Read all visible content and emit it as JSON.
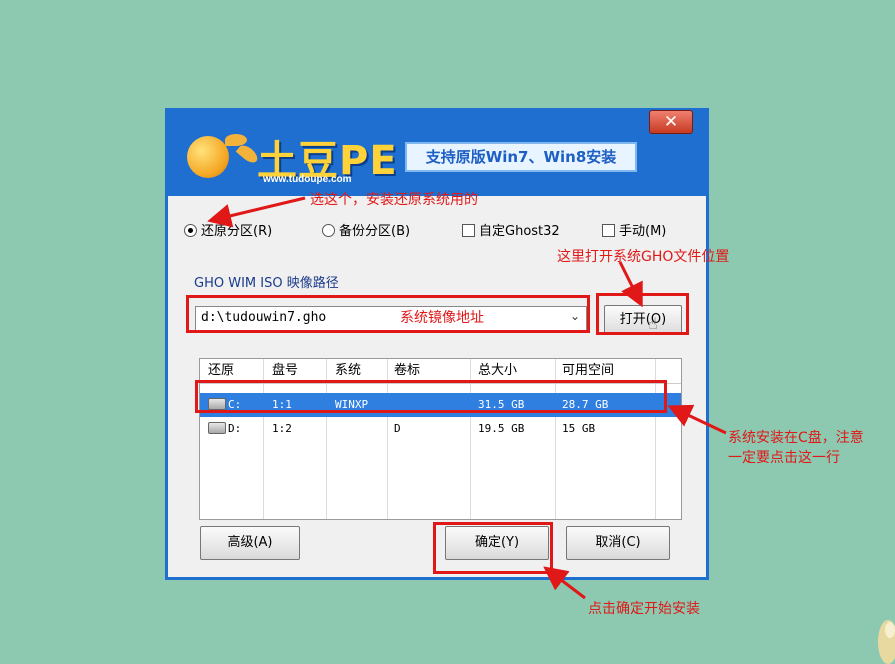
{
  "title": {
    "brand": "土豆PE",
    "url": "www.tudoupe.com",
    "banner": "支持原版Win7、Win8安装",
    "close_icon": "close-icon"
  },
  "options": [
    {
      "label": "还原分区(R)",
      "type": "radio",
      "checked": true
    },
    {
      "label": "备份分区(B)",
      "type": "radio",
      "checked": false
    },
    {
      "label": "自定Ghost32",
      "type": "checkbox",
      "checked": false
    },
    {
      "label": "手动(M)",
      "type": "checkbox",
      "checked": false
    }
  ],
  "image_path": {
    "label": "GHO WIM ISO 映像路径",
    "value": "d:\\tudouwin7.gho",
    "open_button": "打开(O)"
  },
  "table": {
    "columns": [
      "还原",
      "盘号",
      "系统",
      "卷标",
      "总大小",
      "可用空间"
    ],
    "rows": [
      {
        "drive": "C:",
        "disk_no": "1:1",
        "system": "WINXP",
        "volume": "",
        "total": "31.5 GB",
        "free": "28.7 GB",
        "selected": true
      },
      {
        "drive": "D:",
        "disk_no": "1:2",
        "system": "",
        "volume": "D",
        "total": "19.5 GB",
        "free": "15 GB",
        "selected": false
      }
    ]
  },
  "buttons": {
    "advanced": "高级(A)",
    "ok": "确定(Y)",
    "cancel": "取消(C)"
  },
  "annotations": {
    "select_hint": "选这个，安装还原系统用的",
    "open_hint": "这里打开系统GHO文件位置",
    "path_hint": "系统镜像地址",
    "drive_hint_1": "系统安装在C盘，注意",
    "drive_hint_2": "一定要点击这一行",
    "ok_hint": "点击确定开始安装",
    "color": "#e01818"
  },
  "colors": {
    "window_border": "#1e6fd0",
    "selection": "#2e7fe0",
    "desktop": "#8cc9b0"
  }
}
